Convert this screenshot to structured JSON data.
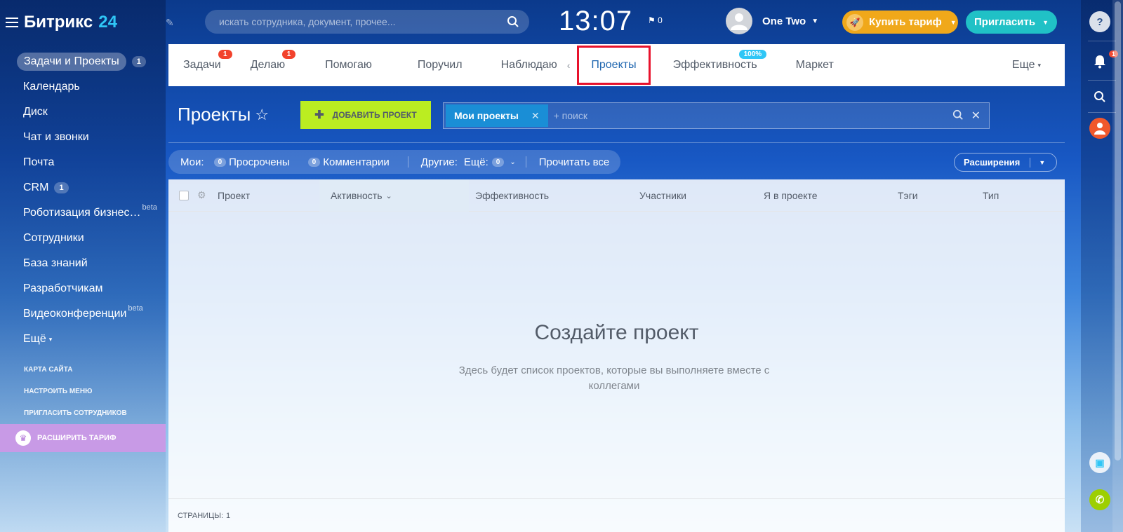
{
  "app": {
    "logo_text": "Битрикс",
    "logo_num": "24"
  },
  "search": {
    "placeholder": "искать сотрудника, документ, прочее..."
  },
  "header": {
    "time": "13:07",
    "flag_count": "0",
    "user_name": "One Two",
    "buy_label": "Купить тариф",
    "invite_label": "Пригласить"
  },
  "sidebar": {
    "items": [
      {
        "label": "Задачи и Проекты",
        "counter": "1"
      },
      {
        "label": "Календарь"
      },
      {
        "label": "Диск"
      },
      {
        "label": "Чат и звонки"
      },
      {
        "label": "Почта"
      },
      {
        "label": "CRM",
        "counter": "1"
      },
      {
        "label": "Роботизация бизнес…",
        "beta": "beta"
      },
      {
        "label": "Сотрудники"
      },
      {
        "label": "База знаний"
      },
      {
        "label": "Разработчикам"
      },
      {
        "label": "Видеоконференции",
        "beta": "beta"
      },
      {
        "label": "Ещё"
      }
    ],
    "links": [
      "Карта сайта",
      "Настроить меню",
      "Пригласить сотрудников"
    ],
    "upgrade_label": "Расширить тариф"
  },
  "tabs": [
    {
      "label": "Задачи",
      "badge": "1"
    },
    {
      "label": "Делаю",
      "badge": "1"
    },
    {
      "label": "Помогаю"
    },
    {
      "label": "Поручил"
    },
    {
      "label": "Наблюдаю"
    },
    {
      "label": "Проекты",
      "active": true
    },
    {
      "label": "Эффективность",
      "badge": "100%"
    },
    {
      "label": "Маркет"
    }
  ],
  "tabs_more": "Еще",
  "page": {
    "title": "Проекты",
    "add_button": "Добавить проект",
    "filter_chip": "Мои проекты",
    "filter_placeholder": "+ поиск"
  },
  "counters": {
    "mine_label": "Мои:",
    "overdue_count": "0",
    "overdue_label": "Просрочены",
    "comments_count": "0",
    "comments_label": "Комментарии",
    "others_label": "Другие:",
    "more_label": "Ещё:",
    "more_count": "0",
    "read_all": "Прочитать все"
  },
  "extensions_label": "Расширения",
  "table": {
    "columns": [
      "Проект",
      "Активность",
      "Эффективность",
      "Участники",
      "Я в проекте",
      "Тэги",
      "Тип"
    ],
    "empty_title": "Создайте проект",
    "empty_text": "Здесь будет список проектов, которые вы выполняете вместе с коллегами",
    "pages_label": "Страницы:",
    "pages_value": "1"
  },
  "rightbar": {
    "notif_count": "1"
  },
  "colors": {
    "accent": "#2fc6f6",
    "add_button": "#bbed21",
    "buy": "#f0a81a",
    "invite": "#20c1c6",
    "highlight": "#e8122c"
  }
}
